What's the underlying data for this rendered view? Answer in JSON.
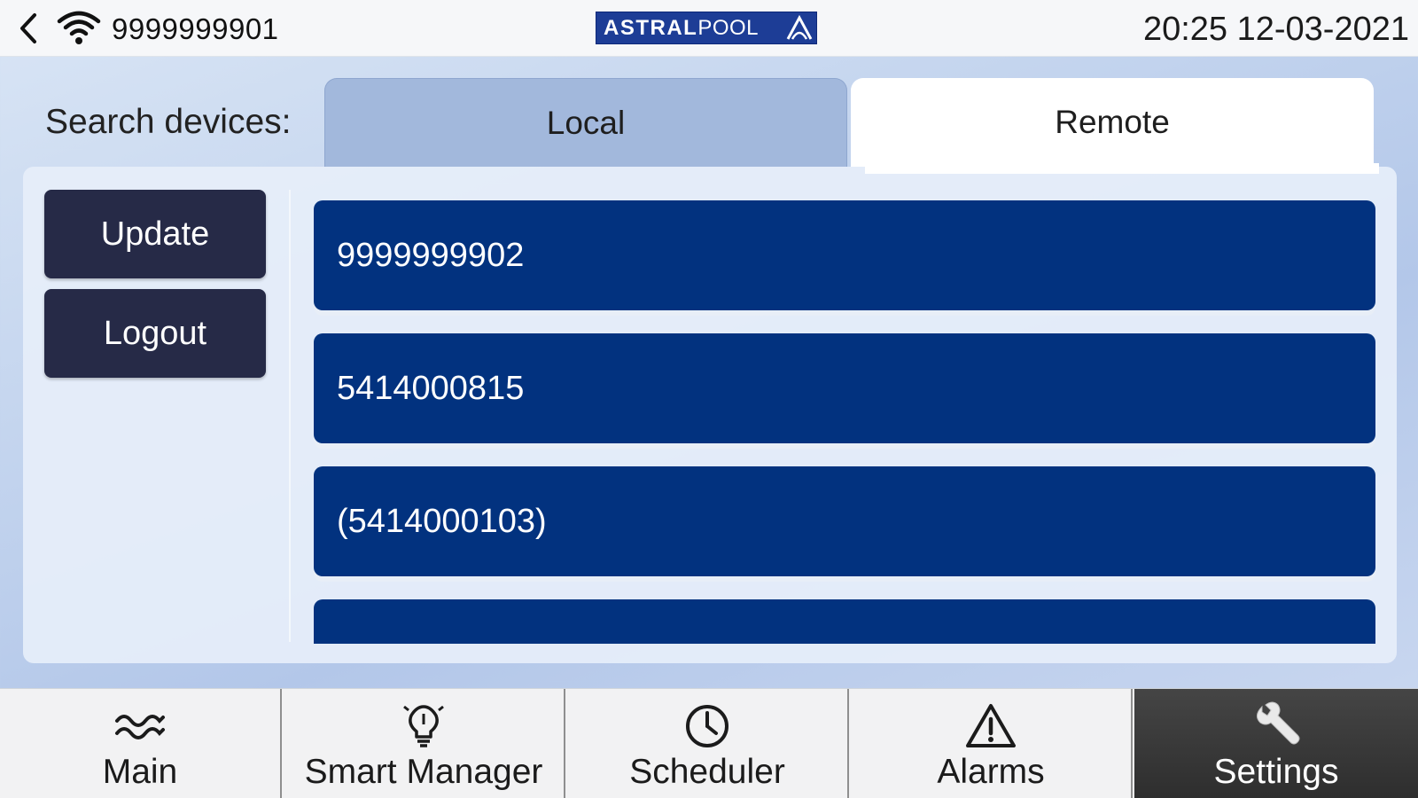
{
  "header": {
    "device_id": "9999999901",
    "logo_bold": "ASTRAL",
    "logo_thin": "POOL",
    "datetime": "20:25 12-03-2021"
  },
  "search": {
    "label": "Search devices:",
    "tabs": [
      {
        "label": "Local",
        "state": "inactive"
      },
      {
        "label": "Remote",
        "state": "active"
      }
    ]
  },
  "actions": {
    "update_label": "Update",
    "logout_label": "Logout"
  },
  "devices": [
    {
      "label": "9999999902"
    },
    {
      "label": "5414000815"
    },
    {
      "label": "(5414000103)"
    },
    {
      "label": ""
    }
  ],
  "nav": {
    "items": [
      {
        "label": "Main",
        "icon": "waves-icon"
      },
      {
        "label": "Smart Manager",
        "icon": "lightbulb-icon"
      },
      {
        "label": "Scheduler",
        "icon": "clock-icon"
      },
      {
        "label": "Alarms",
        "icon": "warning-icon"
      },
      {
        "label": "Settings",
        "icon": "wrench-icon",
        "active": true
      }
    ]
  },
  "colors": {
    "accent_blue": "#02327f",
    "button_dark": "#262a47",
    "logo_blue": "#1d3d96",
    "tab_inactive": "#a2b8dc",
    "nav_active": "#3a3a3a"
  }
}
